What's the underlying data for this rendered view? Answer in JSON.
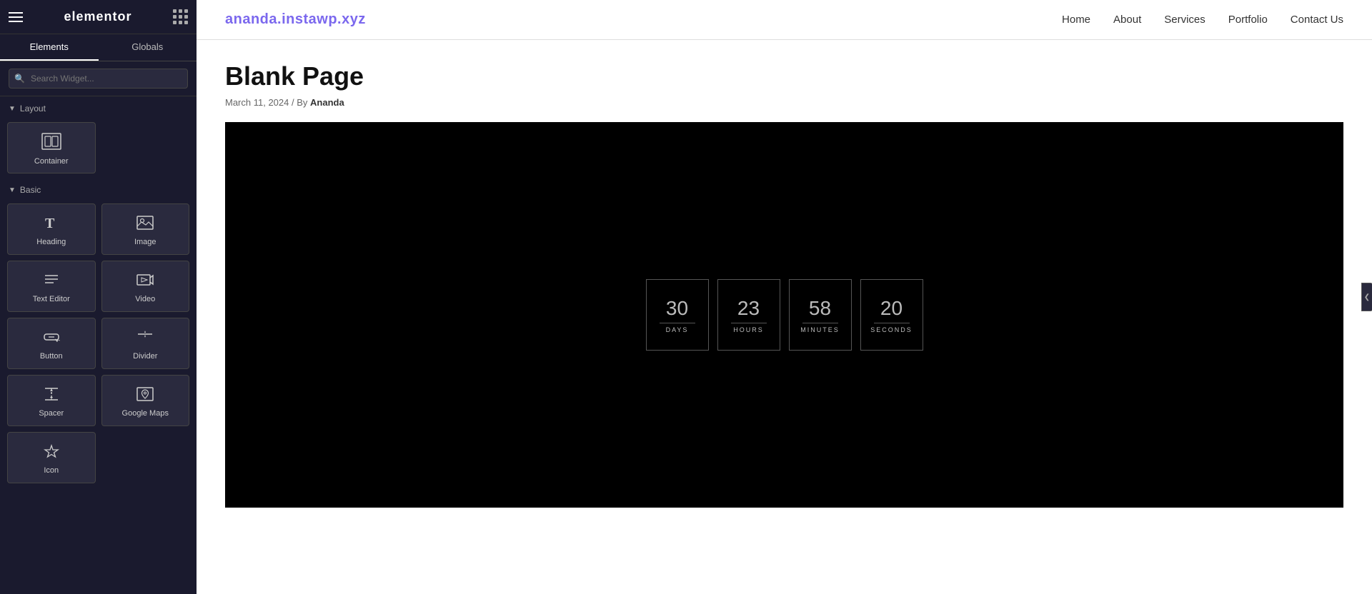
{
  "panel": {
    "logo": "elementor",
    "tabs": [
      {
        "label": "Elements",
        "active": true
      },
      {
        "label": "Globals",
        "active": false
      }
    ],
    "search_placeholder": "Search Widget...",
    "layout_section_label": "Layout",
    "layout_widgets": [
      {
        "id": "container",
        "label": "Container",
        "icon": "container-icon"
      }
    ],
    "basic_section_label": "Basic",
    "basic_widgets": [
      {
        "id": "heading",
        "label": "Heading",
        "icon": "heading-icon"
      },
      {
        "id": "image",
        "label": "Image",
        "icon": "image-icon"
      },
      {
        "id": "text-editor",
        "label": "Text Editor",
        "icon": "text-editor-icon"
      },
      {
        "id": "video",
        "label": "Video",
        "icon": "video-icon"
      },
      {
        "id": "button",
        "label": "Button",
        "icon": "button-icon"
      },
      {
        "id": "divider",
        "label": "Divider",
        "icon": "divider-icon"
      },
      {
        "id": "spacer",
        "label": "Spacer",
        "icon": "spacer-icon"
      },
      {
        "id": "google-maps",
        "label": "Google Maps",
        "icon": "google-maps-icon"
      },
      {
        "id": "icon",
        "label": "Icon",
        "icon": "icon-widget-icon"
      }
    ]
  },
  "nav": {
    "site_domain": "ananda.instawp.xyz",
    "links": [
      {
        "label": "Home"
      },
      {
        "label": "About"
      },
      {
        "label": "Services"
      },
      {
        "label": "Portfolio"
      },
      {
        "label": "Contact Us"
      }
    ]
  },
  "page": {
    "title": "Blank Page",
    "meta_date": "March 11, 2024",
    "meta_by": "By",
    "meta_author": "Ananda"
  },
  "countdown": {
    "days_value": "30",
    "days_label": "DAYS",
    "hours_value": "23",
    "hours_label": "HOURS",
    "minutes_value": "58",
    "minutes_label": "MINUTES",
    "seconds_value": "20",
    "seconds_label": "SECONDS"
  },
  "colors": {
    "site_domain": "#7b68ee",
    "panel_bg": "#1a1a2e",
    "countdown_bg": "#000"
  }
}
